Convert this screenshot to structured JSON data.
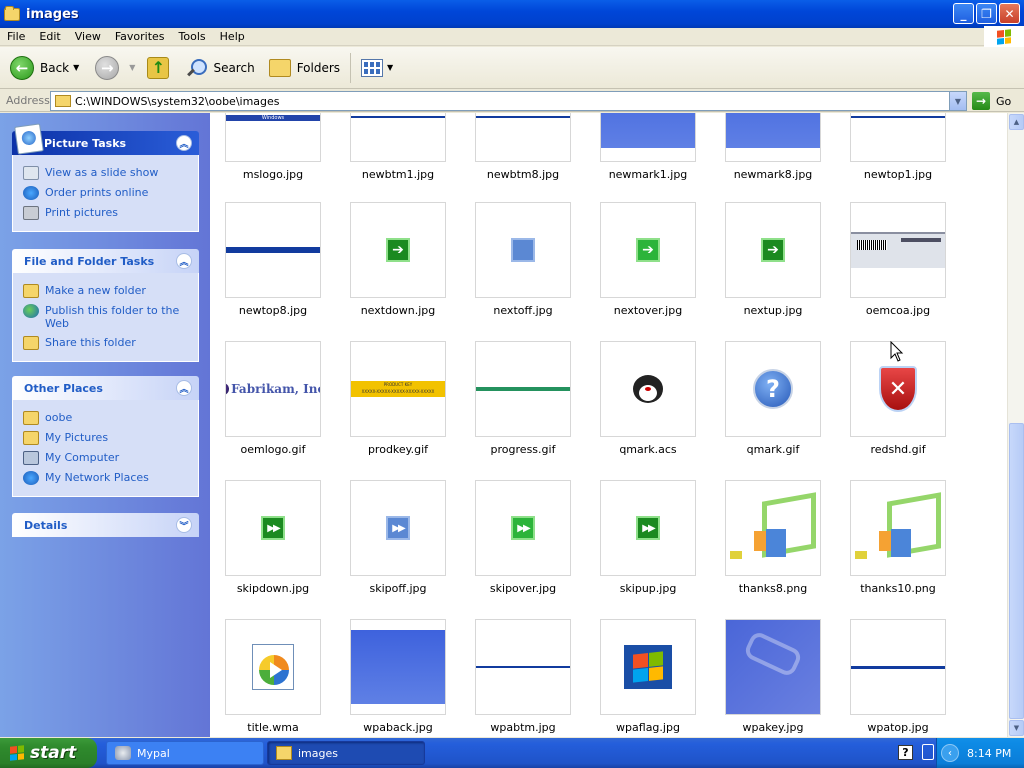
{
  "window": {
    "title": "images"
  },
  "menu": [
    "File",
    "Edit",
    "View",
    "Favorites",
    "Tools",
    "Help"
  ],
  "toolbar": {
    "back": "Back",
    "search": "Search",
    "folders": "Folders"
  },
  "address": {
    "label": "Address",
    "path": "C:\\WINDOWS\\system32\\oobe\\images",
    "go": "Go"
  },
  "taskpane": {
    "picture_tasks": {
      "title": "Picture Tasks",
      "items": [
        "View as a slide show",
        "Order prints online",
        "Print pictures"
      ]
    },
    "file_tasks": {
      "title": "File and Folder Tasks",
      "items": [
        "Make a new folder",
        "Publish this folder to the Web",
        "Share this folder"
      ]
    },
    "other_places": {
      "title": "Other Places",
      "items": [
        "oobe",
        "My Pictures",
        "My Computer",
        "My Network Places"
      ]
    },
    "details": {
      "title": "Details"
    }
  },
  "files": [
    "mslogo.jpg",
    "newbtm1.jpg",
    "newbtm8.jpg",
    "newmark1.jpg",
    "newmark8.jpg",
    "newtop1.jpg",
    "newtop8.jpg",
    "nextdown.jpg",
    "nextoff.jpg",
    "nextover.jpg",
    "nextup.jpg",
    "oemcoa.jpg",
    "oemlogo.gif",
    "prodkey.gif",
    "progress.gif",
    "qmark.acs",
    "qmark.gif",
    "redshd.gif",
    "skipdown.jpg",
    "skipoff.jpg",
    "skipover.jpg",
    "skipup.jpg",
    "thanks8.png",
    "thanks10.png",
    "title.wma",
    "wpaback.jpg",
    "wpabtm.jpg",
    "wpaflag.jpg",
    "wpakey.jpg",
    "wpatop.jpg"
  ],
  "thumb_text": {
    "mslogo": "Windows",
    "oemlogo": "Fabrikam, Inc.",
    "prodkey_top": "PRODUCT KEY",
    "prodkey_bottom": "XXXXX-XXXXX-XXXXX-XXXXX-XXXXX"
  },
  "taskbar": {
    "start": "start",
    "tasks": [
      "Mypal",
      "images"
    ],
    "clock": "8:14 PM"
  },
  "colors": {
    "titlebar": "#0046d8",
    "taskpane": "#7ba2e7",
    "start": "#2f8a2d",
    "link": "#215dc6"
  }
}
